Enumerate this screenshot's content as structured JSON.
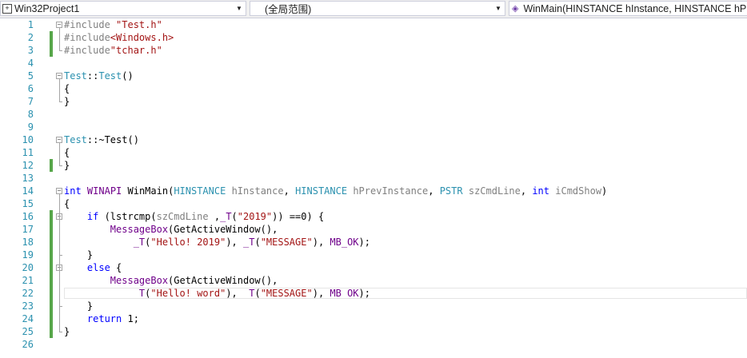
{
  "navbar": {
    "project": "Win32Project1",
    "scope": "(全局范围)",
    "function": "WinMain(HINSTANCE hInstance, HINSTANCE hPrevInstance, PSTR szCmdLine, int iCmdShow)"
  },
  "code": [
    {
      "n": "1",
      "t": "#include \"Test.h\""
    },
    {
      "n": "2",
      "t": "#include<Windows.h>"
    },
    {
      "n": "3",
      "t": "#include\"tchar.h\""
    },
    {
      "n": "4",
      "t": ""
    },
    {
      "n": "5",
      "t": "Test::Test()"
    },
    {
      "n": "6",
      "t": "{"
    },
    {
      "n": "7",
      "t": "}"
    },
    {
      "n": "8",
      "t": ""
    },
    {
      "n": "9",
      "t": ""
    },
    {
      "n": "10",
      "t": "Test::~Test()"
    },
    {
      "n": "11",
      "t": "{"
    },
    {
      "n": "12",
      "t": "}"
    },
    {
      "n": "13",
      "t": ""
    },
    {
      "n": "14",
      "t": "int WINAPI WinMain(HINSTANCE hInstance, HINSTANCE hPrevInstance, PSTR szCmdLine, int iCmdShow)"
    },
    {
      "n": "15",
      "t": "{"
    },
    {
      "n": "16",
      "t": "    if (lstrcmp(szCmdLine ,_T(\"2019\")) ==0) {"
    },
    {
      "n": "17",
      "t": "        MessageBox(GetActiveWindow(),"
    },
    {
      "n": "18",
      "t": "            _T(\"Hello! 2019\"), _T(\"MESSAGE\"), MB_OK);"
    },
    {
      "n": "19",
      "t": "    }"
    },
    {
      "n": "20",
      "t": "    else {"
    },
    {
      "n": "21",
      "t": "        MessageBox(GetActiveWindow(),"
    },
    {
      "n": "22",
      "t": "            _T(\"Hello! word\"), _T(\"MESSAGE\"), MB_OK);"
    },
    {
      "n": "23",
      "t": "    }"
    },
    {
      "n": "24",
      "t": "    return 1;"
    },
    {
      "n": "25",
      "t": "}"
    },
    {
      "n": "26",
      "t": ""
    }
  ],
  "colors": {
    "keyword": "#0000ff",
    "string": "#a31515",
    "preprocessor": "#808080",
    "type": "#2b91af",
    "macro": "#6f008a",
    "line_number": "#2b91af",
    "change_bar": "#57a64a"
  },
  "icons": {
    "project": "project-icon",
    "function": "function-icon",
    "dropdown": "chevron-down-icon"
  }
}
